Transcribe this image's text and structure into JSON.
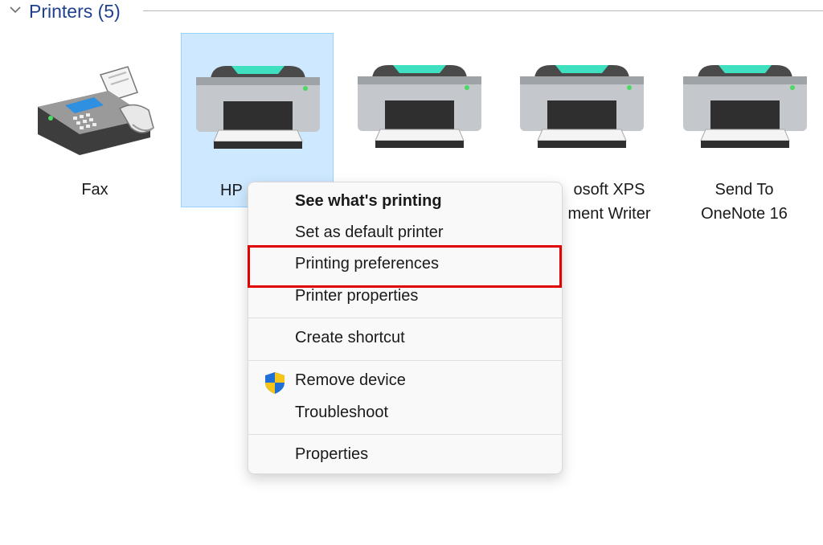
{
  "group": {
    "title": "Printers (5)",
    "chevron_icon": "chevron-down-icon"
  },
  "devices": [
    {
      "label": "Fax",
      "icon": "fax-icon"
    },
    {
      "label": "HP",
      "icon": "printer-icon"
    },
    {
      "label": "",
      "icon": "printer-icon"
    },
    {
      "label": "osoft XPS ment Writer",
      "icon": "printer-icon"
    },
    {
      "label": "Send To OneNote 16",
      "icon": "printer-icon"
    }
  ],
  "context_menu": {
    "items": [
      {
        "label": "See what's printing"
      },
      {
        "label": "Set as default printer"
      },
      {
        "label": "Printing preferences"
      },
      {
        "label": "Printer properties"
      },
      {
        "label": "Create shortcut"
      },
      {
        "label": "Remove device",
        "icon": "uac-shield-icon"
      },
      {
        "label": "Troubleshoot"
      },
      {
        "label": "Properties"
      }
    ]
  },
  "colors": {
    "selection_fill": "#cde8ff",
    "selection_border": "#99d1ff",
    "highlight_border": "#e00000",
    "group_title": "#1f3f8f"
  }
}
